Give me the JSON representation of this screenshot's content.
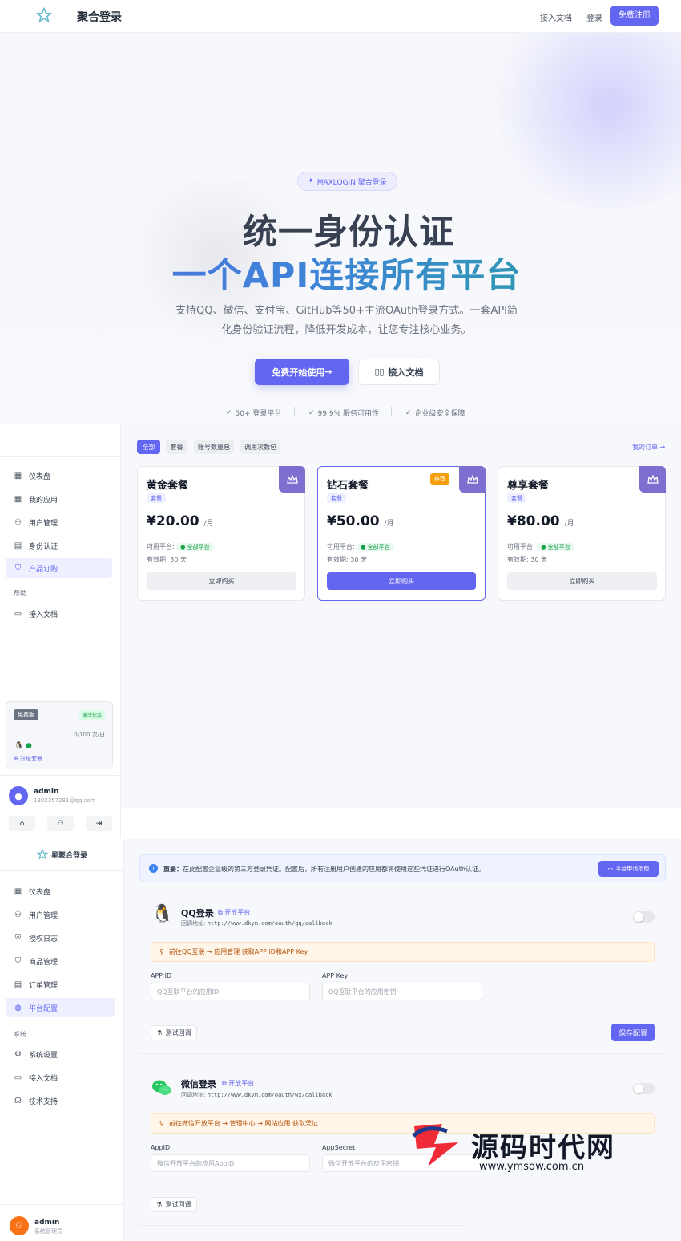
{
  "nav": {
    "brand": "聚合登录",
    "docs": "接入文档",
    "login": "登录",
    "register": "免费注册"
  },
  "hero": {
    "badge": "MAXLOGIN 聚合登录",
    "title_line1": "统一身份认证",
    "title_line2": "一个API连接所有平台",
    "subtitle_line1": "支持QQ、微信、支付宝、GitHub等50+主流OAuth登录方式。一套API简",
    "subtitle_line2": "化身份验证流程，降低开发成本，让您专注核心业务。",
    "cta_primary": "免费开始使用",
    "cta_secondary": "接入文档",
    "features": [
      "50+ 登录平台",
      "99.9% 服务可用性",
      "企业级安全保障"
    ]
  },
  "user_sidebar": {
    "items": [
      {
        "label": "仪表盘",
        "icon": "dashboard-icon"
      },
      {
        "label": "我的应用",
        "icon": "apps-icon"
      },
      {
        "label": "用户管理",
        "icon": "users-icon"
      },
      {
        "label": "身份认证",
        "icon": "id-card-icon"
      },
      {
        "label": "产品订购",
        "icon": "bag-icon"
      }
    ],
    "group_help": "帮助",
    "docs": "接入文档",
    "plan": {
      "name": "免费版",
      "status": "激活状态",
      "usage": "0/100 次/日",
      "upgrade": "升级套餐"
    },
    "user": {
      "name": "admin",
      "email": "1302357281@qq.com"
    }
  },
  "products": {
    "tabs": [
      "全部",
      "套餐",
      "账号数量包",
      "调用次数包"
    ],
    "orders_link": "我的订单 →",
    "cards": [
      {
        "title": "黄金套餐",
        "tag": "套餐",
        "price": "¥20.00",
        "per": "/月",
        "platform_label": "可用平台:",
        "platform": "全部平台",
        "validity": "有效期: 30 天",
        "buy": "立即购买"
      },
      {
        "title": "钻石套餐",
        "tag": "套餐",
        "price": "¥50.00",
        "per": "/月",
        "platform_label": "可用平台:",
        "platform": "全部平台",
        "validity": "有效期: 30 天",
        "buy": "立即购买",
        "hot": "推荐"
      },
      {
        "title": "尊享套餐",
        "tag": "套餐",
        "price": "¥80.00",
        "per": "/月",
        "platform_label": "可用平台:",
        "platform": "全部平台",
        "validity": "有效期: 30 天",
        "buy": "立即购买"
      }
    ]
  },
  "admin_sidebar": {
    "brand": "星聚合登录",
    "items": [
      {
        "label": "仪表盘",
        "icon": "dashboard-icon"
      },
      {
        "label": "用户管理",
        "icon": "user-manage-icon"
      },
      {
        "label": "授权日志",
        "icon": "shield-icon"
      },
      {
        "label": "商品管理",
        "icon": "bag-icon"
      },
      {
        "label": "订单管理",
        "icon": "document-icon"
      },
      {
        "label": "平台配置",
        "icon": "globe-icon"
      }
    ],
    "group_system": "系统",
    "system_items": [
      {
        "label": "系统设置",
        "icon": "gear-icon"
      },
      {
        "label": "接入文档",
        "icon": "book-icon"
      },
      {
        "label": "技术支持",
        "icon": "headset-icon"
      }
    ],
    "user": {
      "name": "admin",
      "role": "系统管理员"
    }
  },
  "config": {
    "notice_bold": "重要：",
    "notice": "在此配置企业级的第三方登录凭证。配置后，所有注册用户创建的应用都将使用这些凭证进行OAuth认证。",
    "guide_button": "平台申请指南",
    "qq": {
      "title": "QQ登录",
      "open_link": "开放平台",
      "callback_label": "回调地址:",
      "callback": "http://www.dkym.com/oauth/qq/callback",
      "tip": "前往QQ互联 → 应用管理 获取APP ID和APP Key",
      "id_label": "APP ID",
      "id_placeholder": "QQ互联平台的应用ID",
      "key_label": "APP Key",
      "key_placeholder": "QQ互联平台的应用密钥",
      "test": "测试回调",
      "save": "保存配置"
    },
    "wx": {
      "title": "微信登录",
      "open_link": "开放平台",
      "callback_label": "回调地址:",
      "callback": "http://www.dkym.com/oauth/wx/callback",
      "tip": "前往微信开放平台 → 管理中心 → 网站应用 获取凭证",
      "id_label": "AppID",
      "id_placeholder": "微信开放平台的应用AppID",
      "key_label": "AppSecret",
      "key_placeholder": "微信开放平台的应用密钥",
      "test": "测试回调"
    }
  },
  "watermark": {
    "name": "源码时代网",
    "url": "www.ymsdw.com.cn"
  },
  "colors": {
    "accent": "#6366f1",
    "success": "#16a34a",
    "warning": "#f59e0b"
  }
}
